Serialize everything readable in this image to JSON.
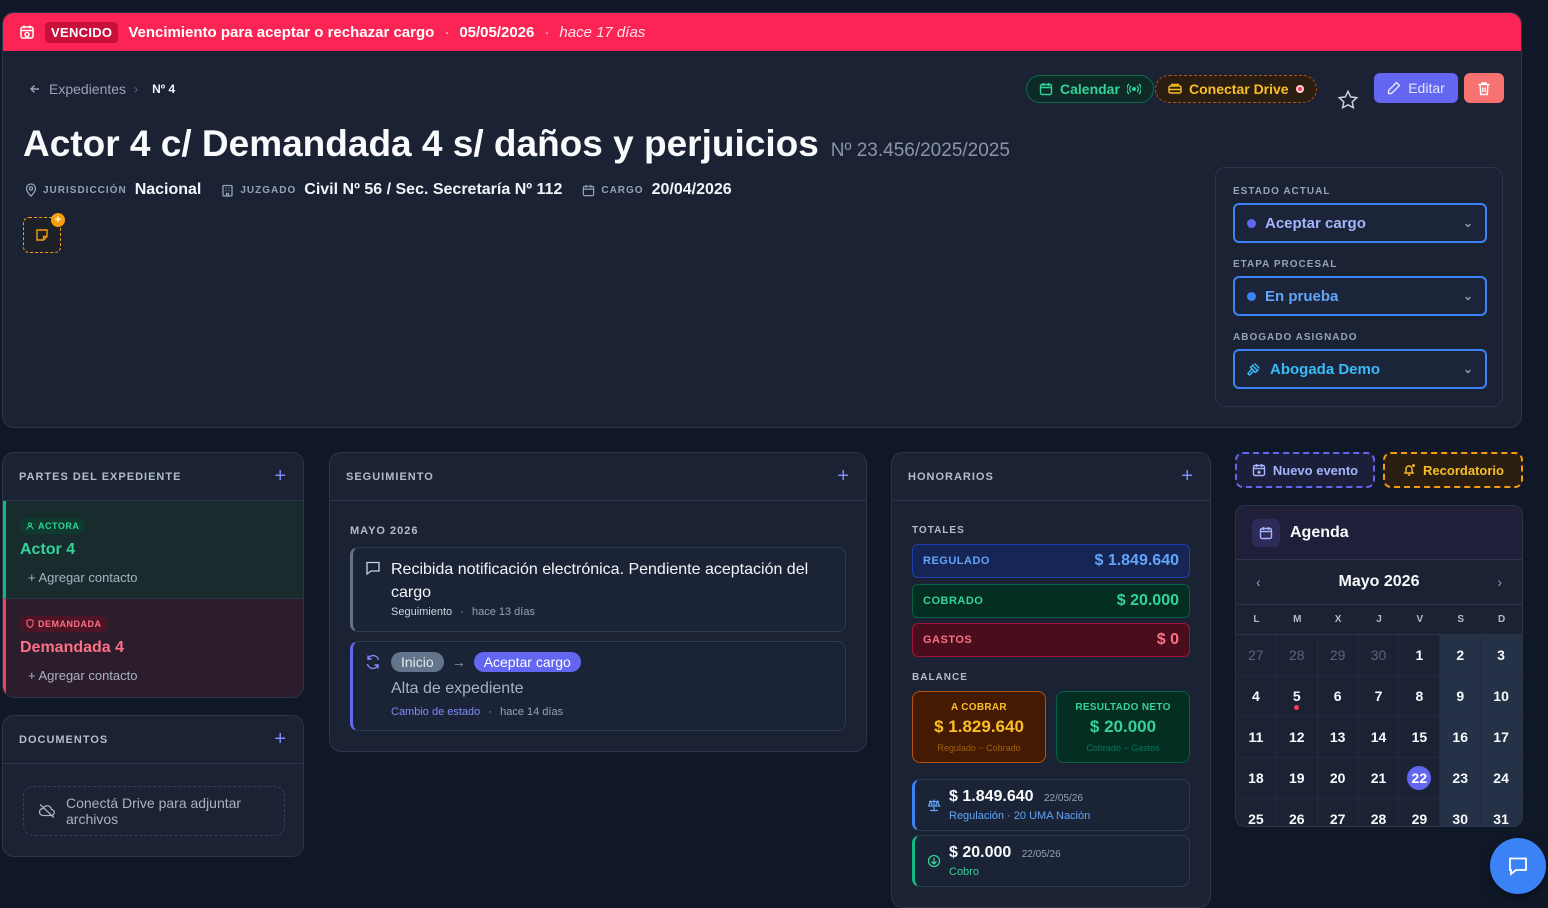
{
  "alert": {
    "badge": "VENCIDO",
    "message": "Vencimiento para aceptar o rechazar cargo",
    "separator": "·",
    "date": "05/05/2026",
    "ago": "hace 17 días",
    "color": "#fb2454"
  },
  "breadcrumb": {
    "back": "Expedientes",
    "chevron": "›",
    "number": "Nº 4"
  },
  "header_actions": {
    "calendar": "Calendar",
    "drive": "Conectar Drive",
    "edit": "Editar"
  },
  "case": {
    "title": "Actor 4 c/ Demandada 4 s/ daños y perjuicios",
    "number": "Nº 23.456/2025/2025",
    "meta": [
      {
        "label": "JURISDICCIÓN",
        "value": "Nacional",
        "icon": "location-icon"
      },
      {
        "label": "JUZGADO",
        "value": "Civil Nº 56 / Sec. Secretaría Nº 112",
        "icon": "building-icon"
      },
      {
        "label": "CARGO",
        "value": "20/04/2026",
        "icon": "calendar-icon"
      }
    ],
    "note_plus": "+"
  },
  "status": {
    "estado_label": "ESTADO ACTUAL",
    "estado_value": "Aceptar cargo",
    "etapa_label": "ETAPA PROCESAL",
    "etapa_value": "En prueba",
    "abogado_label": "ABOGADO ASIGNADO",
    "abogado_value": "Abogada Demo",
    "caret": "⌄"
  },
  "partes": {
    "title": "PARTES DEL EXPEDIENTE",
    "plus": "+",
    "items": [
      {
        "role": "ACTORA",
        "name": "Actor 4",
        "add": "+ Agregar contacto"
      },
      {
        "role": "DEMANDADA",
        "name": "Demandada 4",
        "add": "+ Agregar contacto"
      }
    ]
  },
  "documentos": {
    "title": "DOCUMENTOS",
    "plus": "+",
    "empty": "Conectá Drive para adjuntar archivos"
  },
  "seguimiento": {
    "title": "SEGUIMIENTO",
    "plus": "+",
    "month": "MAYO 2026",
    "entries": [
      {
        "text": "Recibida notificación electrónica. Pendiente aceptación del cargo",
        "type": "Seguimiento",
        "sep": "·",
        "ago": "hace 13 días"
      },
      {
        "from": "Inicio",
        "arrow": "→",
        "to": "Aceptar cargo",
        "text": "Alta de expediente",
        "type": "Cambio de estado",
        "sep": "·",
        "ago": "hace 14 días"
      }
    ]
  },
  "honorarios": {
    "title": "HONORARIOS",
    "plus": "+",
    "totales_label": "TOTALES",
    "totales": [
      {
        "label": "REGULADO",
        "value": "$ 1.849.640"
      },
      {
        "label": "COBRADO",
        "value": "$ 20.000"
      },
      {
        "label": "GASTOS",
        "value": "$ 0"
      }
    ],
    "balance_label": "BALANCE",
    "balance": [
      {
        "title": "A COBRAR",
        "value": "$ 1.829.640",
        "sub": "Regulado − Cobrado"
      },
      {
        "title": "RESULTADO NETO",
        "value": "$ 20.000",
        "sub": "Cobrado − Gastos"
      }
    ],
    "movimientos": [
      {
        "amount": "$ 1.849.640",
        "date": "22/05/26",
        "sub": "Regulación · 20 UMA Nación"
      },
      {
        "amount": "$ 20.000",
        "date": "22/05/26",
        "sub": "Cobro"
      }
    ]
  },
  "agenda": {
    "nuevo_evento": "Nuevo evento",
    "recordatorio": "Recordatorio",
    "title": "Agenda",
    "month": "Mayo 2026",
    "prev": "‹",
    "next": "›",
    "weekdays": [
      "L",
      "M",
      "X",
      "J",
      "V",
      "S",
      "D"
    ],
    "days": [
      "27",
      "28",
      "29",
      "30",
      "1",
      "2",
      "3",
      "4",
      "5",
      "6",
      "7",
      "8",
      "9",
      "10",
      "11",
      "12",
      "13",
      "14",
      "15",
      "16",
      "17",
      "18",
      "19",
      "20",
      "21",
      "22",
      "23",
      "24",
      "25",
      "26",
      "27",
      "28",
      "29",
      "30",
      "31"
    ],
    "outside_month": [
      0,
      1,
      2,
      3
    ],
    "today_index": 25,
    "event_index": 8
  }
}
